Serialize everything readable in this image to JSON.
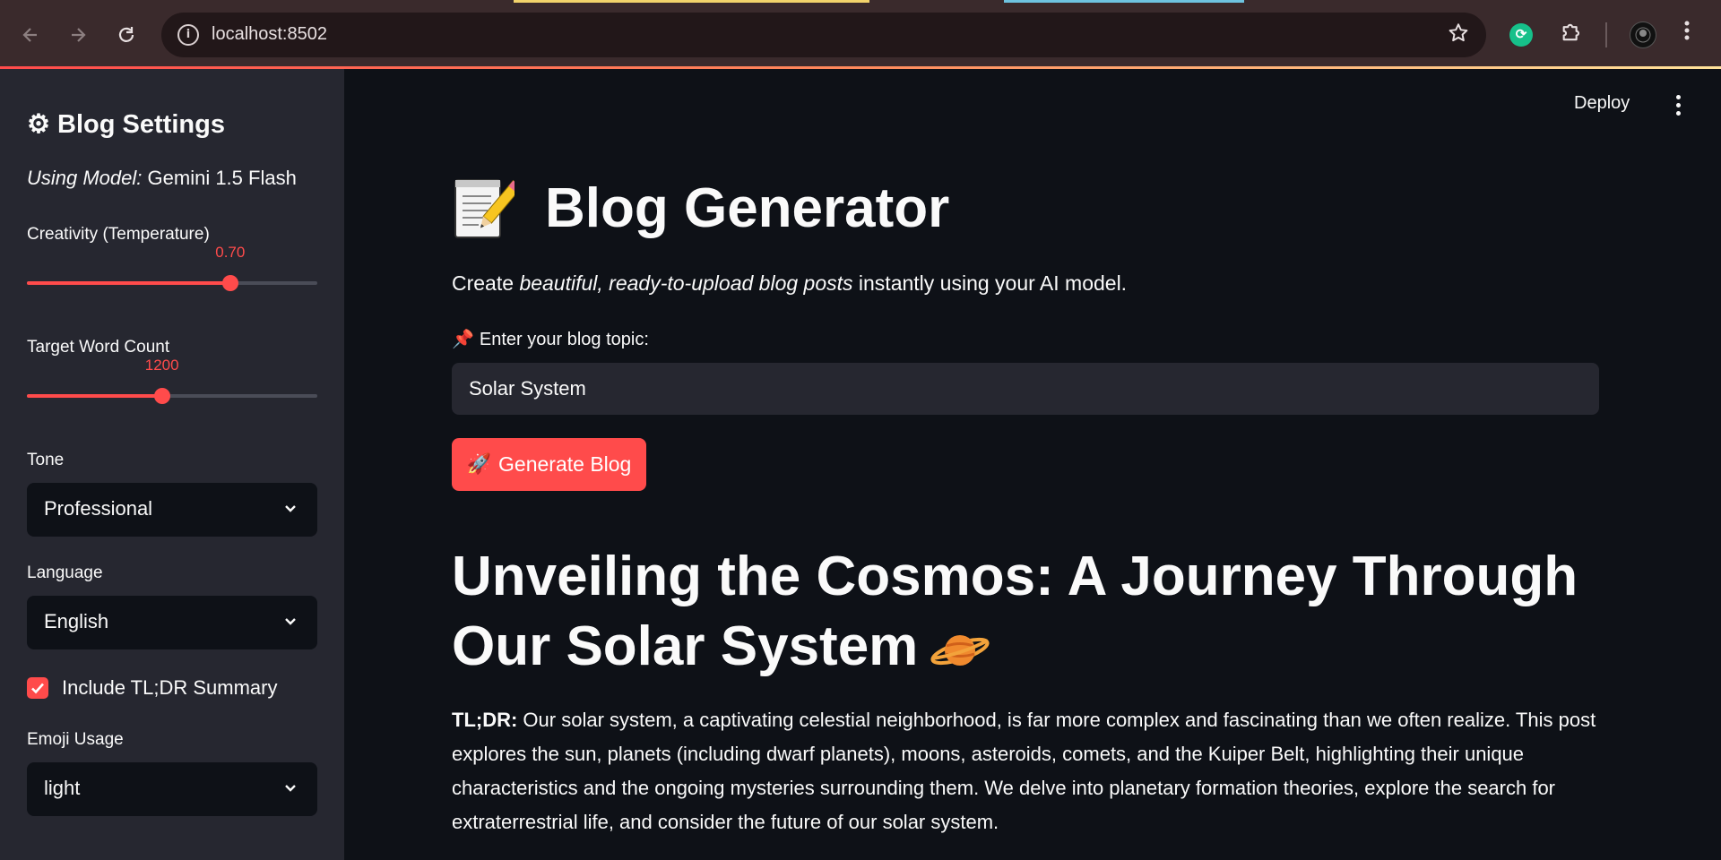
{
  "browser": {
    "url": "localhost:8502"
  },
  "sidebar": {
    "title": "⚙ Blog Settings",
    "model_label": "Using Model:",
    "model_name": "Gemini 1.5 Flash",
    "temperature": {
      "label": "Creativity (Temperature)",
      "value": "0.70",
      "min": 0,
      "max": 1,
      "current": 0.7
    },
    "word_count": {
      "label": "Target Word Count",
      "value": "1200",
      "fraction": 0.465
    },
    "tone": {
      "label": "Tone",
      "selected": "Professional"
    },
    "language": {
      "label": "Language",
      "selected": "English"
    },
    "tldr_checkbox": {
      "label": "Include TL;DR Summary",
      "checked": true
    },
    "emoji_usage": {
      "label": "Emoji Usage",
      "selected": "light"
    }
  },
  "header": {
    "deploy_label": "Deploy"
  },
  "main": {
    "title": "Blog Generator",
    "subtitle_before": "Create ",
    "subtitle_italic": "beautiful, ready-to-upload blog posts",
    "subtitle_after": " instantly using your AI model.",
    "topic_label": "Enter your blog topic:",
    "topic_value": "Solar System",
    "generate_label": "Generate Blog",
    "blog_title": "Unveiling the Cosmos: A Journey Through Our Solar System",
    "tldr_label": "TL;DR:",
    "tldr_text": " Our solar system, a captivating celestial neighborhood, is far more complex and fascinating than we often realize. This post explores the sun, planets (including dwarf planets), moons, asteroids, comets, and the Kuiper Belt, highlighting their unique characteristics and the ongoing mysteries surrounding them. We delve into planetary formation theories, explore the search for extraterrestrial life, and consider the future of our solar system."
  },
  "colors": {
    "accent": "#ff4b4b",
    "background": "#0e1117",
    "sidebar": "#262730"
  },
  "icons": [
    "back-arrow-icon",
    "forward-arrow-icon",
    "reload-icon",
    "info-icon",
    "star-icon",
    "extension-sync-icon",
    "puzzle-icon",
    "profile-avatar",
    "kebab-menu-icon",
    "gear-icon",
    "chevron-down-icon",
    "checkmark-icon",
    "memo-icon",
    "pushpin-icon",
    "rocket-icon",
    "ringed-planet-icon"
  ]
}
